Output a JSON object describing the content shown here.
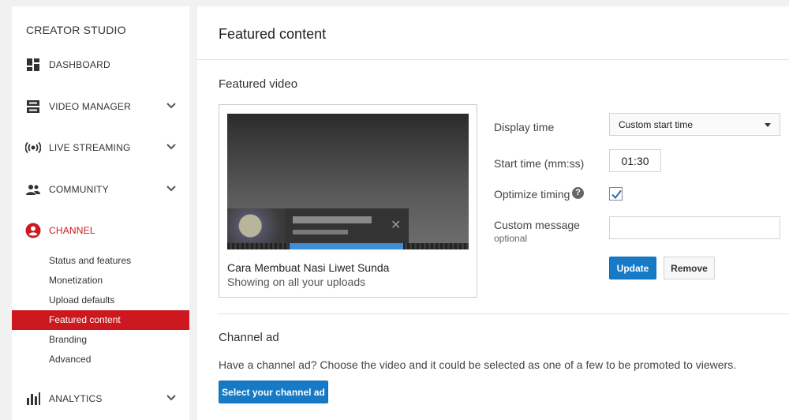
{
  "sidebar": {
    "title": "CREATOR STUDIO",
    "items": [
      {
        "label": "DASHBOARD",
        "icon": "dashboard-icon"
      },
      {
        "label": "VIDEO MANAGER",
        "icon": "video-manager-icon"
      },
      {
        "label": "LIVE STREAMING",
        "icon": "live-streaming-icon"
      },
      {
        "label": "COMMUNITY",
        "icon": "community-icon"
      },
      {
        "label": "CHANNEL",
        "icon": "channel-icon"
      },
      {
        "label": "ANALYTICS",
        "icon": "analytics-icon"
      }
    ],
    "channel_subitems": [
      {
        "label": "Status and features"
      },
      {
        "label": "Monetization"
      },
      {
        "label": "Upload defaults"
      },
      {
        "label": "Featured content"
      },
      {
        "label": "Branding"
      },
      {
        "label": "Advanced"
      }
    ],
    "active_item": "CHANNEL",
    "selected_subitem": "Featured content"
  },
  "main": {
    "title": "Featured content",
    "featured_video": {
      "heading": "Featured video",
      "video_title": "Cara Membuat Nasi Liwet Sunda",
      "video_subtitle": "Showing on all your uploads"
    },
    "form": {
      "display_time_label": "Display time",
      "display_time_value": "Custom start time",
      "start_time_label": "Start time (mm:ss)",
      "start_time_value": "01:30",
      "optimize_label": "Optimize timing",
      "optimize_checked": true,
      "help_glyph": "?",
      "custom_message_label": "Custom message",
      "custom_message_sublabel": "optional",
      "custom_message_value": "",
      "update_label": "Update",
      "remove_label": "Remove"
    },
    "channel_ad": {
      "heading": "Channel ad",
      "description": "Have a channel ad? Choose the video and it could be selected as one of a few to be promoted to viewers.",
      "button_label": "Select your channel ad"
    }
  },
  "colors": {
    "accent_red": "#cc181e",
    "primary_blue": "#167ac6",
    "background": "#f1f1f1"
  }
}
